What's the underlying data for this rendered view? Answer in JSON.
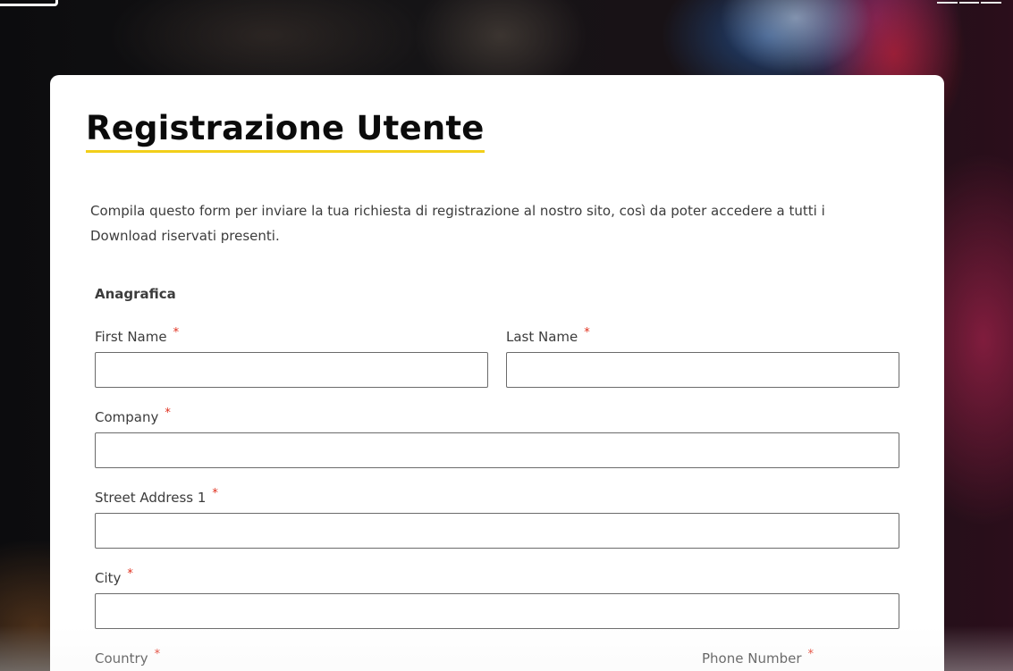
{
  "page": {
    "title": "Registrazione Utente",
    "intro": "Compila questo form per inviare la tua richiesta di registrazione al nostro sito, così da poter accedere a tutti i Download riservati presenti."
  },
  "form": {
    "section": "Anagrafica",
    "required_marker": "*",
    "fields": {
      "first_name": {
        "label": "First Name",
        "value": ""
      },
      "last_name": {
        "label": "Last Name",
        "value": ""
      },
      "company": {
        "label": "Company",
        "value": ""
      },
      "street_address_1": {
        "label": "Street Address 1",
        "value": ""
      },
      "city": {
        "label": "City",
        "value": ""
      },
      "country": {
        "label": "Country",
        "value": ""
      },
      "phone_number": {
        "label": "Phone Number",
        "value": ""
      }
    }
  },
  "colors": {
    "title_underline": "#f2cf1a",
    "required_marker": "#e0301e",
    "card_background": "#ffffff"
  }
}
